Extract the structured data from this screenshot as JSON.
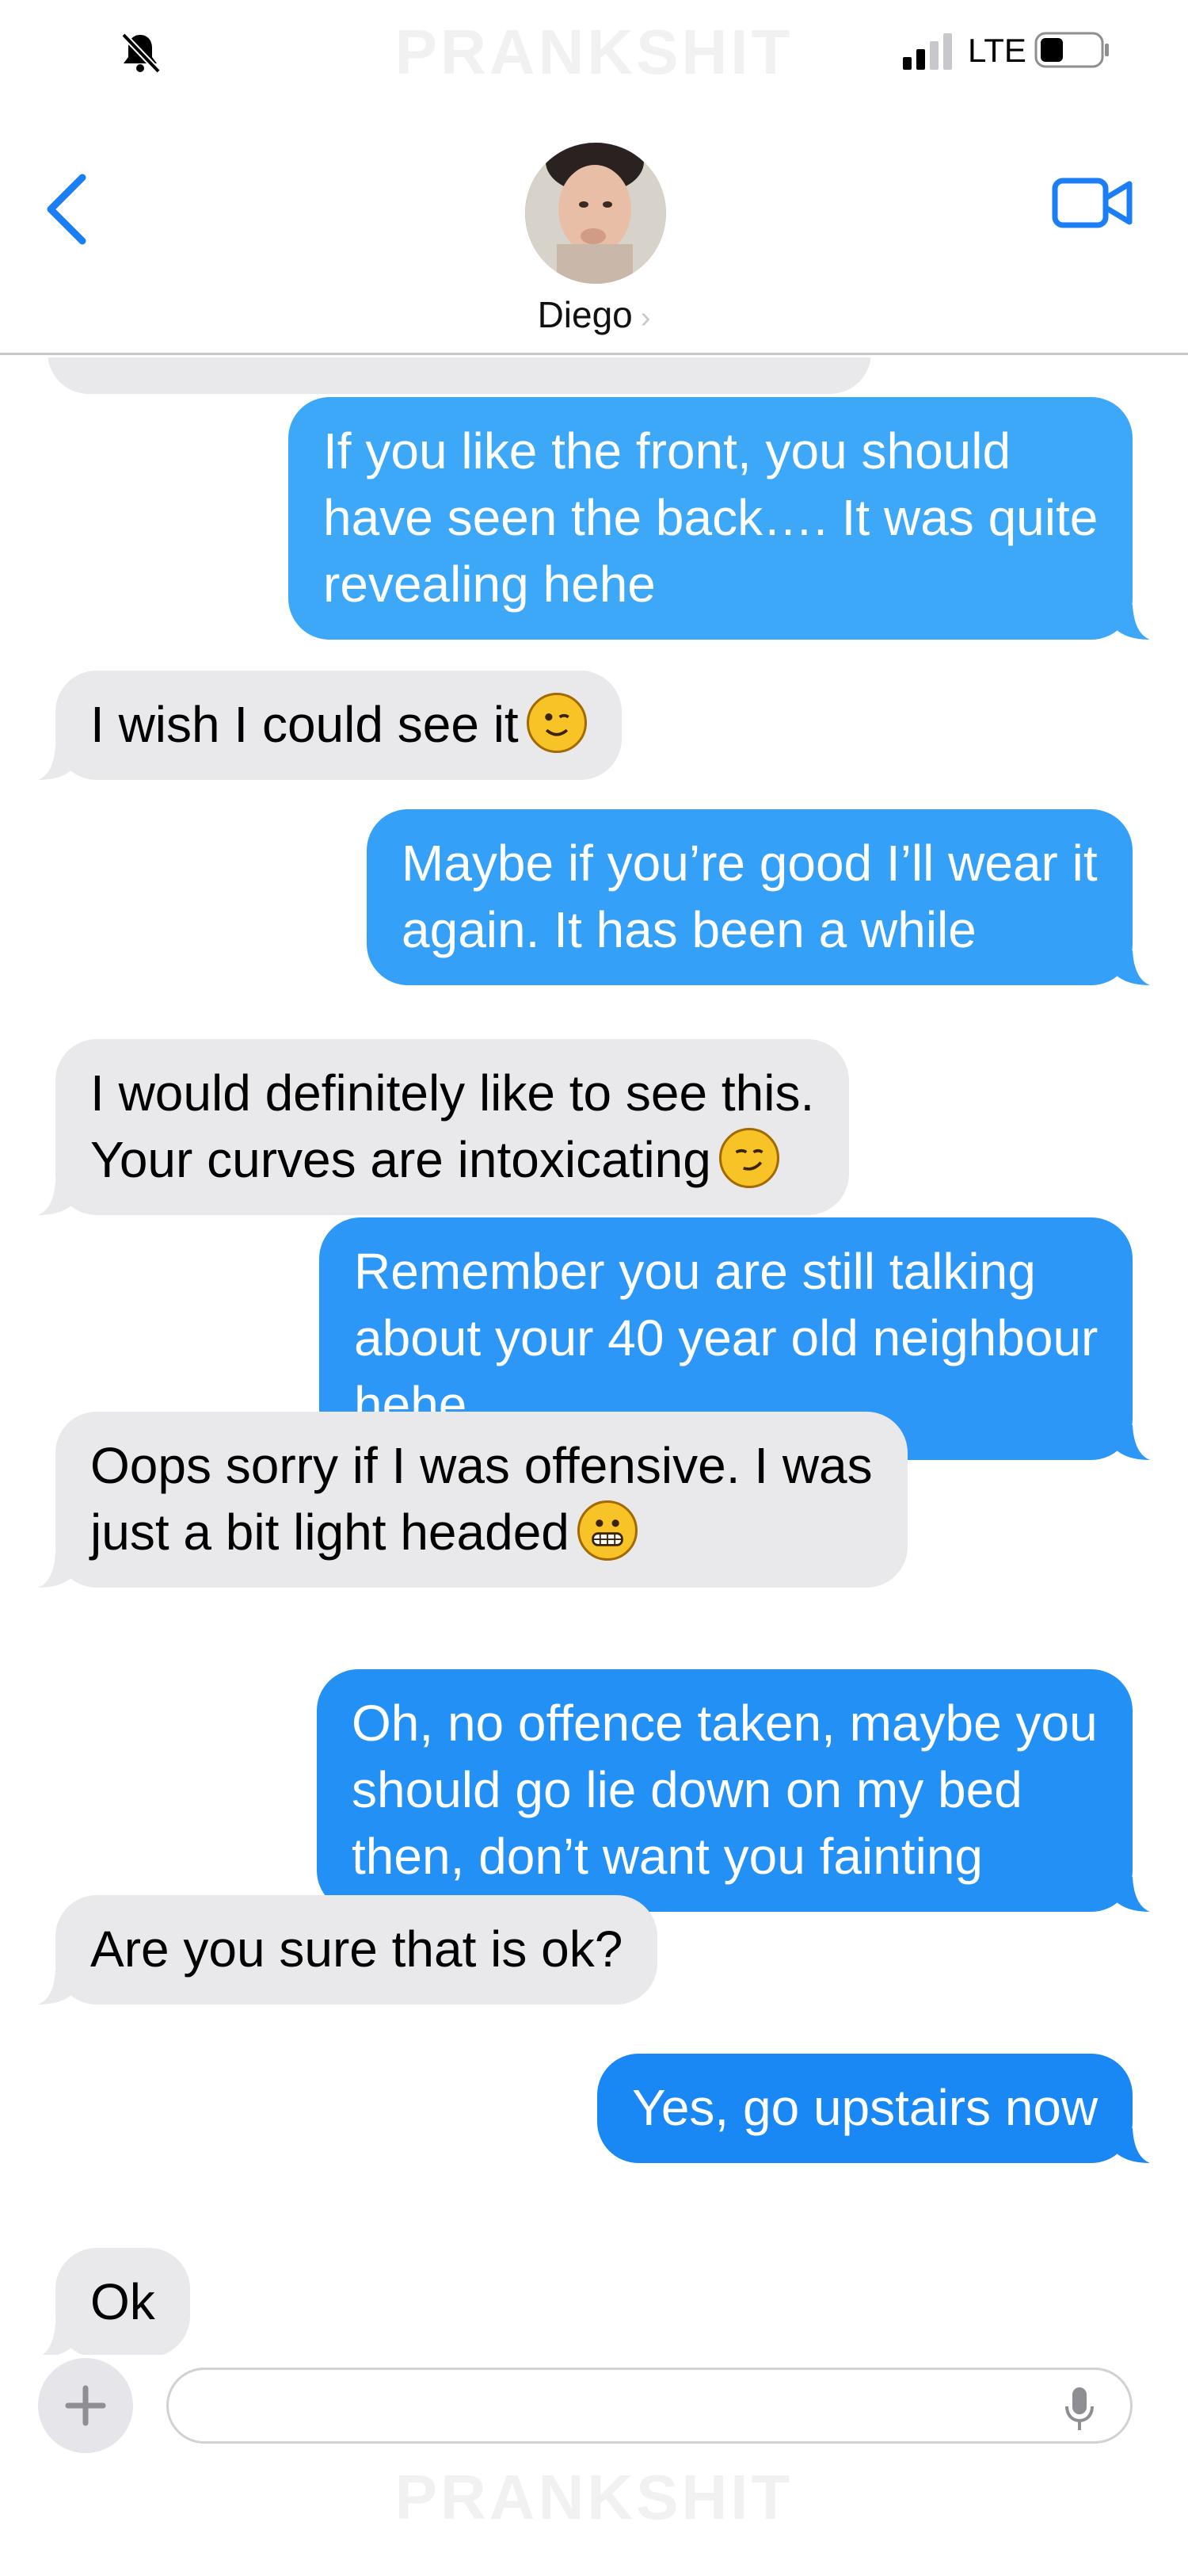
{
  "watermark": "PRANKSHIT",
  "status_bar": {
    "network": "LTE",
    "icons": [
      "mute-bell-icon",
      "signal-bars-icon",
      "battery-icon"
    ]
  },
  "header": {
    "contact_name": "Diego",
    "chevron": "›",
    "icons": [
      "back-chevron-icon",
      "video-camera-icon"
    ]
  },
  "colors": {
    "accent": "#1b7ef4",
    "outgoing_light": "#3ea8f8",
    "outgoing_dark": "#0a7cf2",
    "incoming": "#e9e9eb"
  },
  "messages": [
    {
      "from": "me",
      "lines": [
        "If you like the front, you should",
        "have seen the back…. It was quite",
        "revealing hehe"
      ]
    },
    {
      "from": "them",
      "lines": [
        "I wish I could see it"
      ],
      "emoji": "winking-face-emoji"
    },
    {
      "from": "me",
      "lines": [
        "Maybe if you’re good I’ll wear it",
        "again. It has been a while"
      ]
    },
    {
      "from": "them",
      "lines": [
        "I would definitely like to see this.",
        "Your curves are intoxicating"
      ],
      "emoji": "smirking-face-emoji"
    },
    {
      "from": "me",
      "lines": [
        "Remember you are still talking",
        "about your 40 year old neighbour",
        "hehe"
      ]
    },
    {
      "from": "them",
      "lines": [
        "Oops sorry if I was offensive. I was",
        "just a bit light headed"
      ],
      "emoji": "grimacing-face-emoji"
    },
    {
      "from": "me",
      "lines": [
        "Oh, no offence taken, maybe you",
        "should go lie down on my bed",
        "then, don’t want you fainting"
      ]
    },
    {
      "from": "them",
      "lines": [
        "Are you sure that is ok?"
      ]
    },
    {
      "from": "me",
      "lines": [
        "Yes, go upstairs now"
      ]
    },
    {
      "from": "them",
      "lines": [
        "Ok"
      ]
    }
  ],
  "input_bar": {
    "placeholder": "",
    "icons": [
      "plus-icon",
      "microphone-icon"
    ]
  }
}
